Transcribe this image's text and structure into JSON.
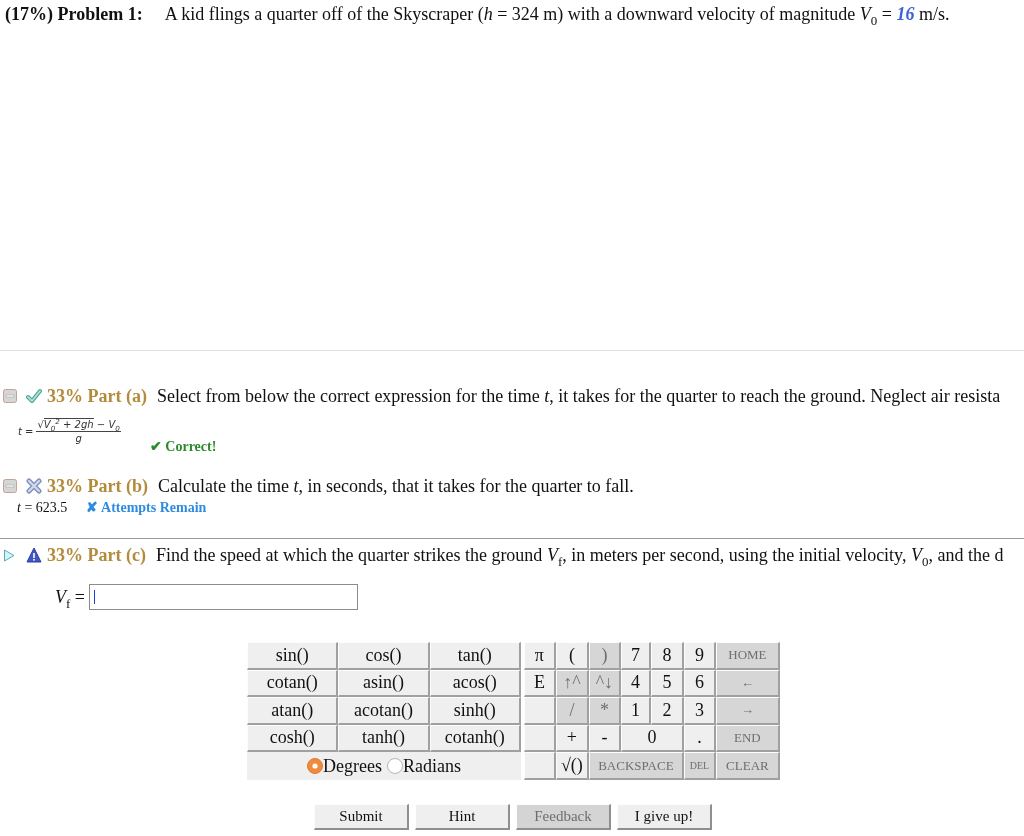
{
  "problem": {
    "title": "(17%) Problem 1:",
    "statement": "A kid flings a quarter off of the Skyscraper (*h* = 324 m) with a downward velocity of magnitude *V*$_{0}$ = **16** m/s."
  },
  "parts": [
    {
      "kind": "correct",
      "title": "33% Part (a)",
      "prompt": "Select from below the correct expression for the time *t*, it takes for the quarter to reach the ground. Neglect air resista",
      "formula": {
        "lhs": "t =",
        "radical": "√",
        "radicand": "V$_{0}$$^{2}$ + 2gh",
        "rest": "− V$_{0}$",
        "denominator": "g"
      },
      "feedback": "✔ Correct!"
    },
    {
      "kind": "wrong",
      "title": "33% Part (b)",
      "prompt": "Calculate the time *t*, in seconds, that it takes for the quarter to fall.",
      "answer": "*t* = 623.5",
      "feedback": "✘ Attempts Remain"
    },
    {
      "kind": "current",
      "title": "33% Part (c)",
      "prompt": "Find the speed at which the quarter strikes the ground *V*$_{f}$, in meters per second, using the initial velocity, *V*$_{0}$, and the d",
      "input_label": "*V*$_{f}$ ="
    }
  ],
  "keypad": {
    "functions": [
      "sin()",
      "cos()",
      "tan()",
      "cotan()",
      "asin()",
      "acos()",
      "atan()",
      "acotan()",
      "sinh()",
      "cosh()",
      "tanh()",
      "cotanh()"
    ],
    "angle_modes": [
      {
        "label": "Degrees",
        "selected": true
      },
      {
        "label": "Radians",
        "selected": false
      }
    ],
    "rows": [
      [
        {
          "kind": "key",
          "label": "π",
          "disabled": false
        },
        {
          "kind": "key",
          "label": "(",
          "disabled": false
        },
        {
          "kind": "key",
          "label": ")",
          "disabled": true
        },
        {
          "kind": "key",
          "label": "7",
          "disabled": false
        },
        {
          "kind": "key",
          "label": "8",
          "disabled": false
        },
        {
          "kind": "key",
          "label": "9",
          "disabled": false
        },
        {
          "kind": "key",
          "label": "HOME",
          "disabled": true
        }
      ],
      [
        {
          "kind": "key",
          "label": "E",
          "disabled": false
        },
        {
          "kind": "key",
          "label": "↑^",
          "disabled": true
        },
        {
          "kind": "key",
          "label": "^↓",
          "disabled": true
        },
        {
          "kind": "key",
          "label": "4",
          "disabled": false
        },
        {
          "kind": "key",
          "label": "5",
          "disabled": false
        },
        {
          "kind": "key",
          "label": "6",
          "disabled": false
        },
        {
          "kind": "key",
          "label": "←",
          "disabled": true
        }
      ],
      [
        {
          "kind": "blank"
        },
        {
          "kind": "key",
          "label": "/",
          "disabled": true
        },
        {
          "kind": "key",
          "label": "*",
          "disabled": true
        },
        {
          "kind": "key",
          "label": "1",
          "disabled": false
        },
        {
          "kind": "key",
          "label": "2",
          "disabled": false
        },
        {
          "kind": "key",
          "label": "3",
          "disabled": false
        },
        {
          "kind": "key",
          "label": "→",
          "disabled": true
        }
      ],
      [
        {
          "kind": "blank"
        },
        {
          "kind": "key",
          "label": "+",
          "disabled": false
        },
        {
          "kind": "key",
          "label": "-",
          "disabled": false
        },
        {
          "kind": "key",
          "label": "0",
          "disabled": false
        },
        "",
        {
          "kind": "key",
          "label": ".",
          "disabled": false
        },
        {
          "kind": "key",
          "label": "END",
          "disabled": true
        }
      ],
      [
        {
          "kind": "blank"
        },
        {
          "kind": "key",
          "label": "√()",
          "disabled": false
        },
        {
          "kind": "key",
          "label": "BACKSPACE",
          "disabled": true
        },
        "",
        "",
        {
          "kind": "key",
          "label": "DEL",
          "disabled": true
        },
        {
          "kind": "key",
          "label": "CLEAR",
          "disabled": true
        }
      ]
    ]
  },
  "buttons": [
    {
      "label": "Submit",
      "disabled": false
    },
    {
      "label": "Hint",
      "disabled": false
    },
    {
      "label": "Feedback",
      "disabled": true
    },
    {
      "label": "I give up!",
      "disabled": false
    }
  ]
}
